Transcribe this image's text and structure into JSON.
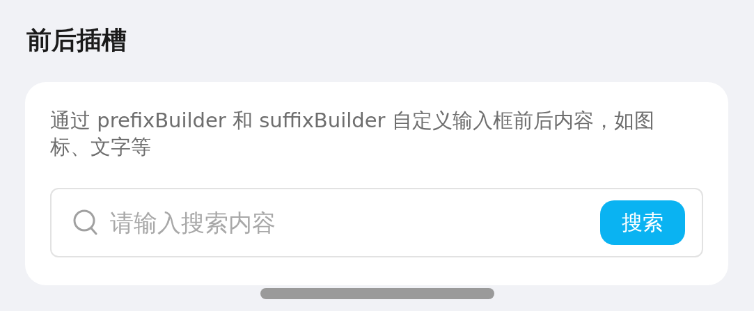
{
  "title": "前后插槽",
  "card": {
    "description": "通过 prefixBuilder 和 suffixBuilder 自定义输入框前后内容，如图标、文字等",
    "search": {
      "placeholder": "请输入搜索内容",
      "button": "搜索"
    }
  }
}
